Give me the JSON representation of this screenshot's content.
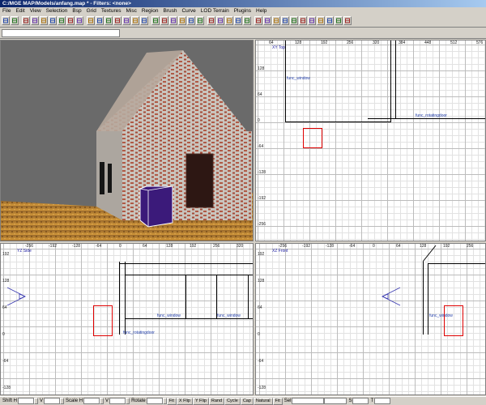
{
  "window": {
    "title": "C:/MGE MAP/Models/anfang.map * - Filters: <none>"
  },
  "menu": [
    "File",
    "Edit",
    "View",
    "Selection",
    "Bsp",
    "Grid",
    "Textures",
    "Misc",
    "Region",
    "Brush",
    "Curve",
    "LOD Terrain",
    "Plugins",
    "Help"
  ],
  "toolbar": {
    "buttons": [
      "open-icon",
      "save-icon",
      "cut-icon",
      "flip-x-icon",
      "flip-y-icon",
      "flip-z-icon",
      "rotate-x-icon",
      "rotate-y-icon",
      "rotate-z-icon",
      "select-complete-icon",
      "select-touching-icon",
      "select-inside-icon",
      "csg-subtract-icon",
      "csg-merge-icon",
      "hollow-icon",
      "clipper-icon",
      "change-views-icon",
      "texture-lock-icon",
      "camera-icon",
      "entity-icon",
      "patch-icon",
      "bend-icon",
      "cap-icon",
      "drill-icon",
      "weld-icon",
      "show-entities-icon",
      "dropdown-icon",
      "plugin-1-icon",
      "plugin-2-icon",
      "plugin-3-icon",
      "plugin-4-icon",
      "plugin-5-icon",
      "plugin-6-icon",
      "plugin-7-icon",
      "plugin-8-icon",
      "plugin-9-icon",
      "plugin-10-icon",
      "plugin-11-icon"
    ]
  },
  "find": {
    "value": ""
  },
  "viewports": {
    "top": {
      "label": "XY Top",
      "x_ticks": [
        "64",
        "128",
        "192",
        "256",
        "320",
        "384",
        "448",
        "512",
        "576"
      ],
      "y_ticks": [
        "128",
        "64",
        "0",
        "-64",
        "-128",
        "-192",
        "-256"
      ],
      "labels": [
        "func_window",
        "func_rotatingdoor"
      ]
    },
    "side": {
      "label": "YZ Side",
      "x_ticks": [
        "-256",
        "-192",
        "-128",
        "-64",
        "0",
        "64",
        "128",
        "192",
        "256",
        "320"
      ],
      "y_ticks": [
        "192",
        "128",
        "64",
        "0",
        "-64",
        "-128"
      ],
      "labels": [
        "func_window",
        "func_window",
        "func_rotatingdoor"
      ]
    },
    "front": {
      "label": "XZ Front",
      "x_ticks": [
        "-256",
        "-192",
        "-128",
        "-64",
        "0",
        "64",
        "128",
        "192",
        "256"
      ],
      "y_ticks": [
        "192",
        "128",
        "64",
        "0",
        "-64",
        "-128"
      ],
      "labels": [
        "func_window"
      ]
    }
  },
  "status": {
    "shift_h": "Shift H",
    "v": "V",
    "scale_h": "Scale H",
    "scale_v": "V",
    "rotate": "Rotate",
    "fit": "Fit",
    "x_flip": "X Flip",
    "y_flip": "Y Flip",
    "rand": "Rand",
    "cycle": "Cycle",
    "cap": "Cap",
    "natural": "Natural",
    "fit2": "Fit",
    "sel": "Sel",
    "s": "S",
    "t": "T"
  },
  "colors": {
    "selection": "#e00000",
    "entity_label": "#1f3ca8",
    "title_start": "#0a246a"
  }
}
